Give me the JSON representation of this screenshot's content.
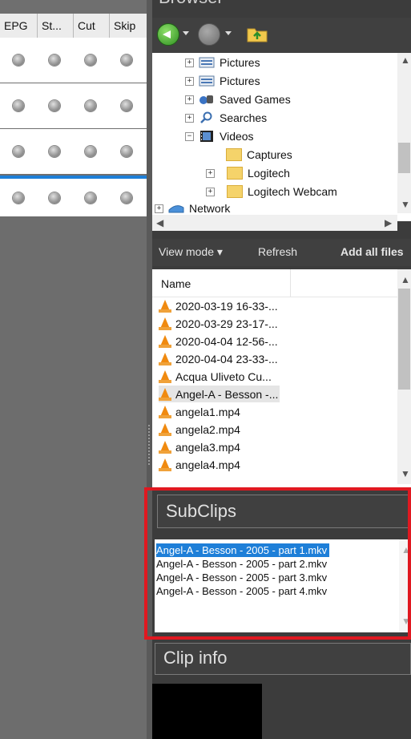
{
  "grid": {
    "columns": [
      "EPG",
      "St...",
      "Cut",
      "Skip"
    ],
    "rows": 4,
    "cols_per_row": 4
  },
  "browser": {
    "title": "Browser",
    "tree": [
      {
        "label": "Pictures",
        "expander": "+",
        "icon": "pictures-library-icon"
      },
      {
        "label": "Pictures",
        "expander": "+",
        "icon": "pictures-library-icon"
      },
      {
        "label": "Saved Games",
        "expander": "+",
        "icon": "saved-games-icon"
      },
      {
        "label": "Searches",
        "expander": "+",
        "icon": "search-folder-icon"
      },
      {
        "label": "Videos",
        "expander": "−",
        "icon": "videos-library-icon"
      },
      {
        "label": "Captures",
        "expander": "",
        "icon": "folder-icon"
      },
      {
        "label": "Logitech",
        "expander": "+",
        "icon": "folder-icon"
      },
      {
        "label": "Logitech Webcam",
        "expander": "+",
        "icon": "folder-icon"
      },
      {
        "label": "Network",
        "expander": "+",
        "icon": "network-icon"
      }
    ],
    "toolbar": {
      "view_mode": "View mode",
      "view_mode_arrow": "▾",
      "refresh": "Refresh",
      "add_all": "Add all files"
    },
    "files_header": "Name",
    "files": [
      "2020-03-19 16-33-...",
      "2020-03-29 23-17-...",
      "2020-04-04 12-56-...",
      "2020-04-04 23-33-...",
      "Acqua Uliveto Cu...",
      "Angel-A - Besson -...",
      "angela1.mp4",
      "angela2.mp4",
      "angela3.mp4",
      "angela4.mp4"
    ],
    "selected_file_index": 5
  },
  "subclips": {
    "title": "SubClips",
    "items": [
      "Angel-A - Besson - 2005 - part 1.mkv",
      "Angel-A - Besson - 2005 - part 2.mkv",
      "Angel-A - Besson - 2005 - part 3.mkv",
      "Angel-A - Besson - 2005 - part 4.mkv"
    ],
    "selected_index": 0
  },
  "clip_info": {
    "title": "Clip info"
  },
  "colors": {
    "highlight": "#e01820",
    "selection": "#1e7fd8",
    "panel": "#404040"
  }
}
